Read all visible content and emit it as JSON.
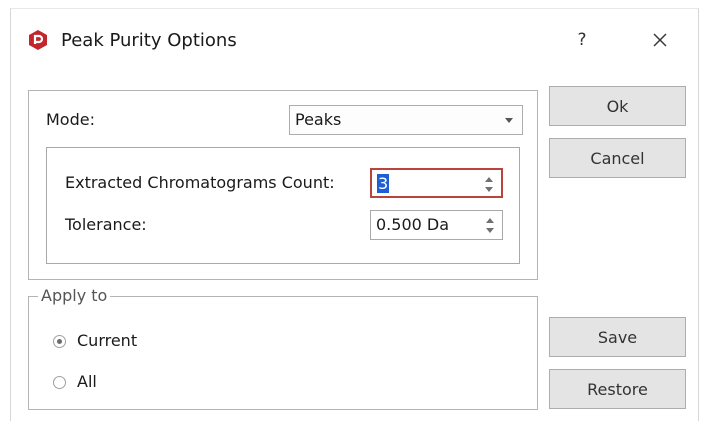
{
  "window": {
    "title": "Peak Purity Options",
    "help_label": "?",
    "app_icon": "red-hexagon-logo-icon",
    "close_icon": "close-icon"
  },
  "mode": {
    "label": "Mode:",
    "selected": "Peaks"
  },
  "chromatograms": {
    "label": "Extracted Chromatograms Count:",
    "value": "3"
  },
  "tolerance": {
    "label": "Tolerance:",
    "value": "0.500 Da"
  },
  "apply_to": {
    "legend": "Apply to",
    "options": [
      {
        "label": "Current",
        "checked": true
      },
      {
        "label": "All",
        "checked": false
      }
    ]
  },
  "buttons": {
    "ok": "Ok",
    "cancel": "Cancel",
    "save": "Save",
    "restore": "Restore"
  },
  "colors": {
    "accent_focus": "#b9443c",
    "selection": "#1e5fd6",
    "logo": "#c0282d"
  }
}
